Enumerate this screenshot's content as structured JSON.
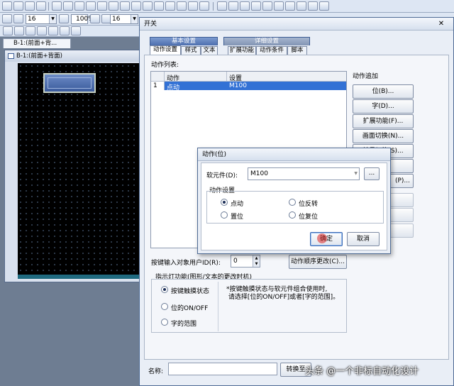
{
  "toolbar": {
    "font_size": "16",
    "zoom": "100%",
    "font_size2": "16"
  },
  "editor": {
    "tab_label": "B-1:(前面+背...",
    "window_title": "B-1:(前面+背面)"
  },
  "switch_dialog": {
    "title": "开关",
    "tab_groups": [
      "基本设置",
      "详细设置"
    ],
    "tabs": [
      "动作设置",
      "样式",
      "文本",
      "扩展功能",
      "动作条件",
      "脚本"
    ],
    "action_list_label": "动作列表:",
    "table": {
      "col_action": "动作",
      "col_setting": "设置",
      "rows": [
        {
          "num": "1",
          "action": "点动",
          "setting": "M100"
        }
      ]
    },
    "add_action_label": "动作追加",
    "buttons": [
      "位(B)...",
      "字(D)...",
      "扩展功能(F)...",
      "画面切换(N)...",
      "站号切换(S)...",
      "",
      "(P)..."
    ],
    "user_id_label": "按键输入对象用户ID(R):",
    "user_id_value": "0",
    "order_button": "动作顺序更改(C)...",
    "indicator_label": "指示灯功能(图形/文本的更改时机)",
    "indicator_options": [
      "按键触摸状态",
      "位的ON/OFF",
      "字的范围"
    ],
    "indicator_note": "*按键触摸状态与软元件组合使用时,\n 请选择[位的ON/OFF]或者[字的范围]。",
    "name_label": "名称:",
    "convert_button": "转换至"
  },
  "action_bit_dialog": {
    "title": "动作(位)",
    "device_label": "软元件(D):",
    "device_value": "M100",
    "browse_button": "...",
    "group_label": "动作设置",
    "options": [
      "点动",
      "置位",
      "位反转",
      "位复位"
    ],
    "ok": "确定",
    "cancel": "取消"
  },
  "watermark": "头条 @一个非标自动化设计"
}
